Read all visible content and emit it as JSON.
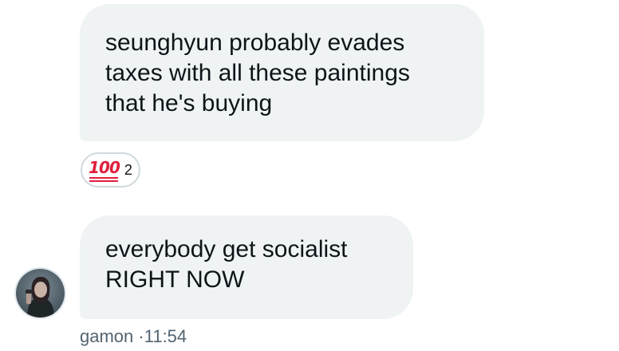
{
  "messages": [
    {
      "lines": [
        "seunghyun probably evades",
        "taxes with all these paintings",
        "that he's buying"
      ],
      "reaction": {
        "emoji": "100",
        "count": "2"
      }
    },
    {
      "lines": [
        "everybody get socialist",
        "RIGHT NOW"
      ],
      "sender": "gamon",
      "separator": "·",
      "time": "11:54"
    }
  ],
  "colors": {
    "bubble": "#eff3f4",
    "text": "#0f1419",
    "meta": "#536471",
    "reaction_border": "#cfd9de",
    "emoji_red": "#e01e3c"
  },
  "icons": {
    "reaction_emoji": "hundred-points-emoji",
    "avatar": "user-avatar-photo"
  }
}
